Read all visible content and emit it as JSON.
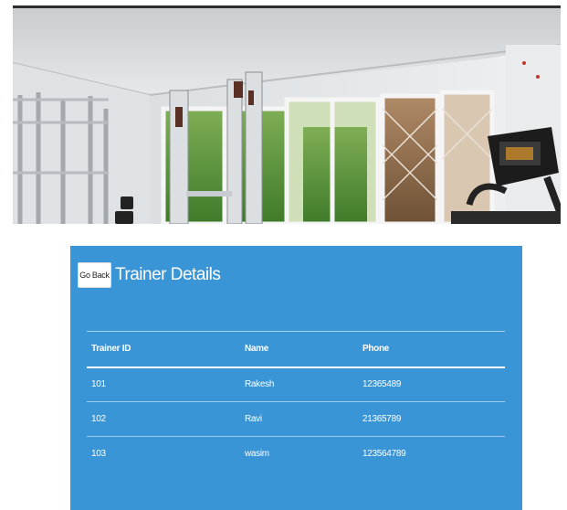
{
  "hero": {
    "image_name": "gym-interior-photo"
  },
  "card": {
    "go_back_label": "Go Back",
    "title": "Trainer Details",
    "background_color": "#3a95d6"
  },
  "table": {
    "columns": [
      "Trainer ID",
      "Name",
      "Phone"
    ],
    "rows": [
      {
        "id": "101",
        "name": "Rakesh",
        "phone": "12365489"
      },
      {
        "id": "102",
        "name": "Ravi",
        "phone": "21365789"
      },
      {
        "id": "103",
        "name": "wasim",
        "phone": "123564789"
      }
    ]
  }
}
